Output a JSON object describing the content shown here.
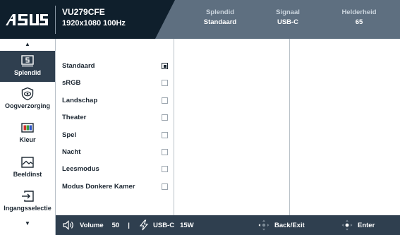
{
  "header": {
    "brand": "/ISUS",
    "model": "VU279CFE",
    "resolution": "1920x1080 100Hz",
    "status": [
      {
        "label": "Splendid",
        "value": "Standaard"
      },
      {
        "label": "Signaal",
        "value": "USB-C"
      },
      {
        "label": "Helderheid",
        "value": "65"
      }
    ]
  },
  "sidebar": {
    "up_arrow": "▲",
    "down_arrow": "▼",
    "items": [
      {
        "label": "Splendid",
        "icon": "splendid-icon",
        "active": true
      },
      {
        "label": "Oogverzorging",
        "icon": "eye-care-icon",
        "active": false
      },
      {
        "label": "Kleur",
        "icon": "color-icon",
        "active": false
      },
      {
        "label": "Beeldinst",
        "icon": "image-icon",
        "active": false
      },
      {
        "label": "Ingangsselectie",
        "icon": "input-select-icon",
        "active": false
      }
    ]
  },
  "options": [
    {
      "label": "Standaard",
      "checked": true
    },
    {
      "label": "sRGB",
      "checked": false
    },
    {
      "label": "Landschap",
      "checked": false
    },
    {
      "label": "Theater",
      "checked": false
    },
    {
      "label": "Spel",
      "checked": false
    },
    {
      "label": "Nacht",
      "checked": false
    },
    {
      "label": "Leesmodus",
      "checked": false
    },
    {
      "label": "Modus Donkere Kamer",
      "checked": false
    }
  ],
  "footer": {
    "volume_label": "Volume",
    "volume_value": "50",
    "separator": "|",
    "usbc_label": "USB-C",
    "usbc_power": "15W",
    "back_label": "Back/Exit",
    "enter_label": "Enter"
  },
  "colors": {
    "header_dark": "#0f1f2c",
    "header_light": "#5e6f80",
    "active_bg": "#2f3f4f",
    "footer_bg": "#2f3f4f"
  }
}
